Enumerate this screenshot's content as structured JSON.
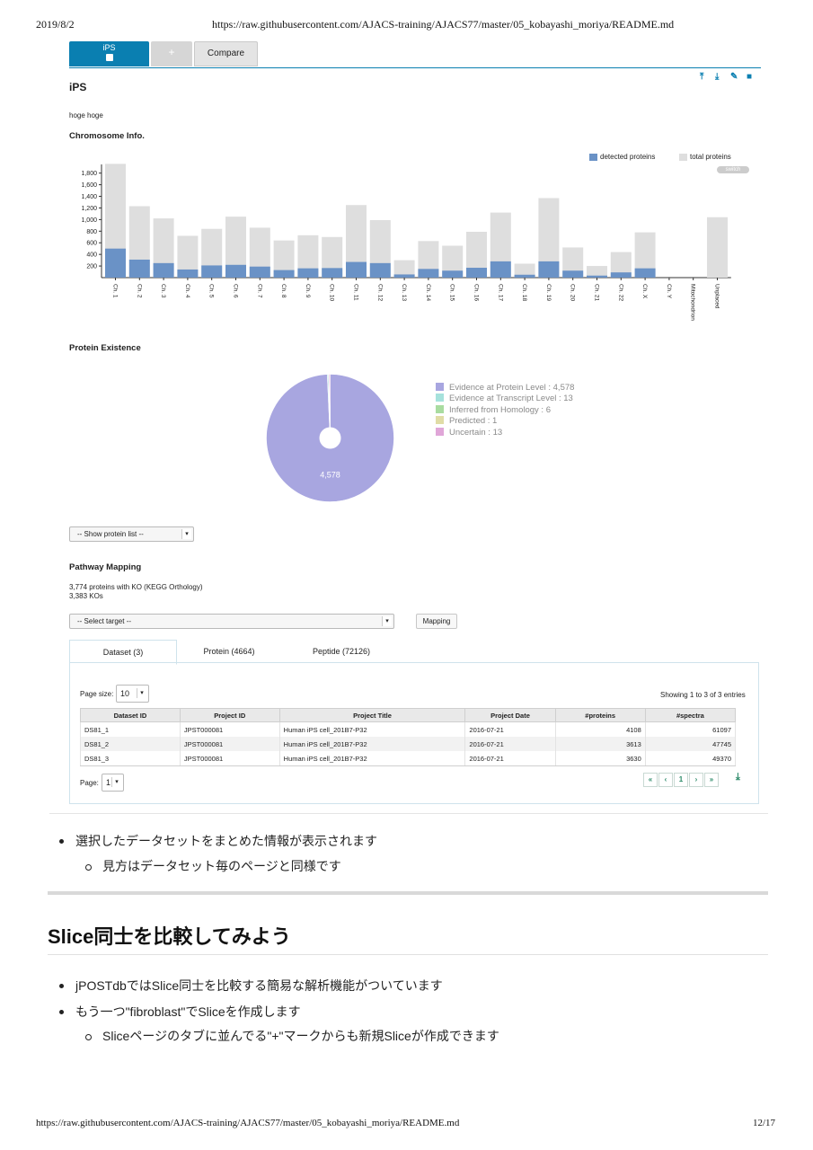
{
  "print": {
    "date": "2019/8/2",
    "url": "https://raw.githubusercontent.com/AJACS-training/AJACS77/master/05_kobayashi_moriya/README.md",
    "page": "12/17"
  },
  "app": {
    "tabs": [
      {
        "label": "iPS"
      },
      {
        "label": "+"
      },
      {
        "label": "Compare"
      }
    ],
    "slice_title": "iPS",
    "description": "hoge hoge",
    "toolbar_icons": [
      "upload-icon",
      "download-icon",
      "edit-icon",
      "trash-icon"
    ],
    "chromosome_section": "Chromosome Info.",
    "switch_label": "switch",
    "protein_existence_section": "Protein Existence",
    "show_protein_list": "-- Show protein list --",
    "pathway_section": "Pathway Mapping",
    "pathway_info": [
      "3,774 proteins with KO (KEGG Orthology)",
      "3,383 KOs"
    ],
    "select_target": "-- Select target --",
    "mapping_button": "Mapping",
    "dataset_tabs": [
      "Dataset (3)",
      "Protein (4664)",
      "Peptide (72126)"
    ],
    "page_size_label": "Page size:",
    "page_size_value": "10",
    "showing_text": "Showing 1 to 3 of 3 entries",
    "table_headers": [
      "Dataset ID",
      "Project ID",
      "Project Title",
      "Project Date",
      "#proteins",
      "#spectra"
    ],
    "table_rows": [
      [
        "DS81_1",
        "JPST000081",
        "Human iPS cell_201B7-P32",
        "2016-07-21",
        "4108",
        "61097"
      ],
      [
        "DS81_2",
        "JPST000081",
        "Human iPS cell_201B7-P32",
        "2016-07-21",
        "3613",
        "47745"
      ],
      [
        "DS81_3",
        "JPST000081",
        "Human iPS cell_201B7-P32",
        "2016-07-21",
        "3630",
        "49370"
      ]
    ],
    "page_label": "Page:",
    "page_value": "1",
    "pager": [
      "«",
      "‹",
      "1",
      "›",
      "»"
    ],
    "pie_label": "4,578"
  },
  "chart_data": [
    {
      "type": "bar",
      "legend": [
        "detected proteins",
        "total proteins"
      ],
      "colors": {
        "detected": "#6a92c6",
        "total": "#dedede"
      },
      "categories": [
        "Ch. 1",
        "Ch. 2",
        "Ch. 3",
        "Ch. 4",
        "Ch. 5",
        "Ch. 6",
        "Ch. 7",
        "Ch. 8",
        "Ch. 9",
        "Ch. 10",
        "Ch. 11",
        "Ch. 12",
        "Ch. 13",
        "Ch. 14",
        "Ch. 15",
        "Ch. 16",
        "Ch. 17",
        "Ch. 18",
        "Ch. 19",
        "Ch. 20",
        "Ch. 21",
        "Ch. 22",
        "Ch. X",
        "Ch. Y",
        "Mitochondrion",
        "Unplaced"
      ],
      "series": [
        {
          "name": "detected proteins",
          "values": [
            500,
            310,
            250,
            140,
            210,
            220,
            190,
            130,
            160,
            165,
            270,
            250,
            55,
            150,
            120,
            170,
            280,
            50,
            280,
            120,
            35,
            90,
            160,
            0,
            0,
            0
          ]
        },
        {
          "name": "total proteins",
          "values": [
            1960,
            1230,
            1020,
            720,
            840,
            1050,
            860,
            640,
            730,
            700,
            1250,
            990,
            300,
            630,
            550,
            790,
            1120,
            240,
            1370,
            520,
            200,
            440,
            780,
            0,
            0,
            1040
          ]
        }
      ],
      "yticks": [
        200,
        400,
        600,
        800,
        1000,
        1200,
        1400,
        1600,
        1800
      ],
      "ylim": [
        0,
        1950
      ]
    },
    {
      "type": "pie",
      "labels": [
        "Evidence at Protein Level : 4,578",
        "Evidence at Transcript Level : 13",
        "Inferred from Homology : 6",
        "Predicted : 1",
        "Uncertain : 13"
      ],
      "values": [
        4578,
        13,
        6,
        1,
        13
      ],
      "colors": [
        "#a8a6e0",
        "#a6e2dc",
        "#a9dca0",
        "#e0dca6",
        "#e0a6d8"
      ]
    }
  ],
  "markdown": {
    "bullet1": "選択したデータセットをまとめた情報が表示されます",
    "sub1": "見方はデータセット毎のページと同様です",
    "heading": "Slice同士を比較してみよう",
    "bullet2": "jPOSTdbではSlice同士を比較する簡易な解析機能がついています",
    "bullet3": "もう一つ\"fibroblast\"でSliceを作成します",
    "sub3": "Sliceページのタブに並んでる\"+\"マークからも新規Sliceが作成できます"
  }
}
